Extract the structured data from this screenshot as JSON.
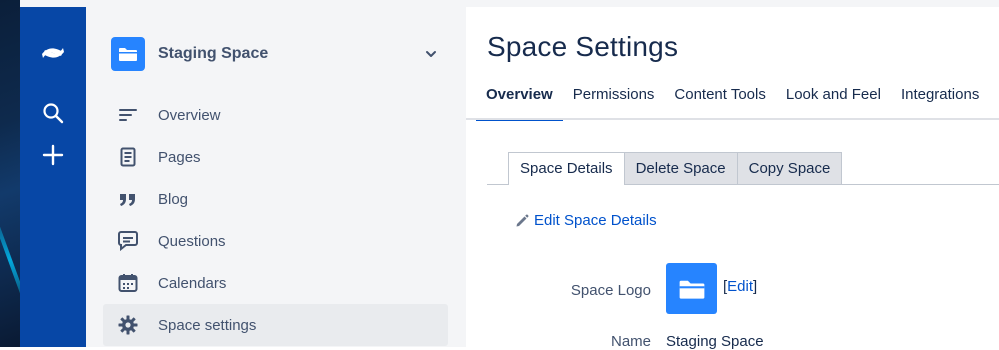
{
  "global_nav": {
    "logo_icon": "confluence-logo-icon",
    "search_icon": "search-icon",
    "create_icon": "plus-icon",
    "color": "#0747a6"
  },
  "sidebar": {
    "space_name": "Staging Space",
    "space_icon": "folder-icon",
    "items": [
      {
        "label": "Overview",
        "icon": "overview-lines-icon"
      },
      {
        "label": "Pages",
        "icon": "page-icon"
      },
      {
        "label": "Blog",
        "icon": "quote-icon"
      },
      {
        "label": "Questions",
        "icon": "question-bubble-icon"
      },
      {
        "label": "Calendars",
        "icon": "calendar-icon"
      },
      {
        "label": "Space settings",
        "icon": "gear-icon",
        "active": true
      }
    ]
  },
  "main": {
    "title": "Space Settings",
    "tabs": [
      {
        "label": "Overview",
        "active": true
      },
      {
        "label": "Permissions"
      },
      {
        "label": "Content Tools"
      },
      {
        "label": "Look and Feel"
      },
      {
        "label": "Integrations"
      }
    ],
    "subtabs": [
      {
        "label": "Space Details",
        "active": true
      },
      {
        "label": "Delete Space"
      },
      {
        "label": "Copy Space"
      }
    ],
    "edit_link": "Edit Space Details",
    "fields": {
      "logo_label": "Space Logo",
      "logo_edit_open": "[",
      "logo_edit_link": "Edit",
      "logo_edit_close": "]",
      "name_label": "Name",
      "name_value": "Staging Space"
    }
  },
  "colors": {
    "accent": "#0052cc",
    "space_avatar": "#2684ff",
    "sidebar_bg": "#f4f5f7"
  }
}
